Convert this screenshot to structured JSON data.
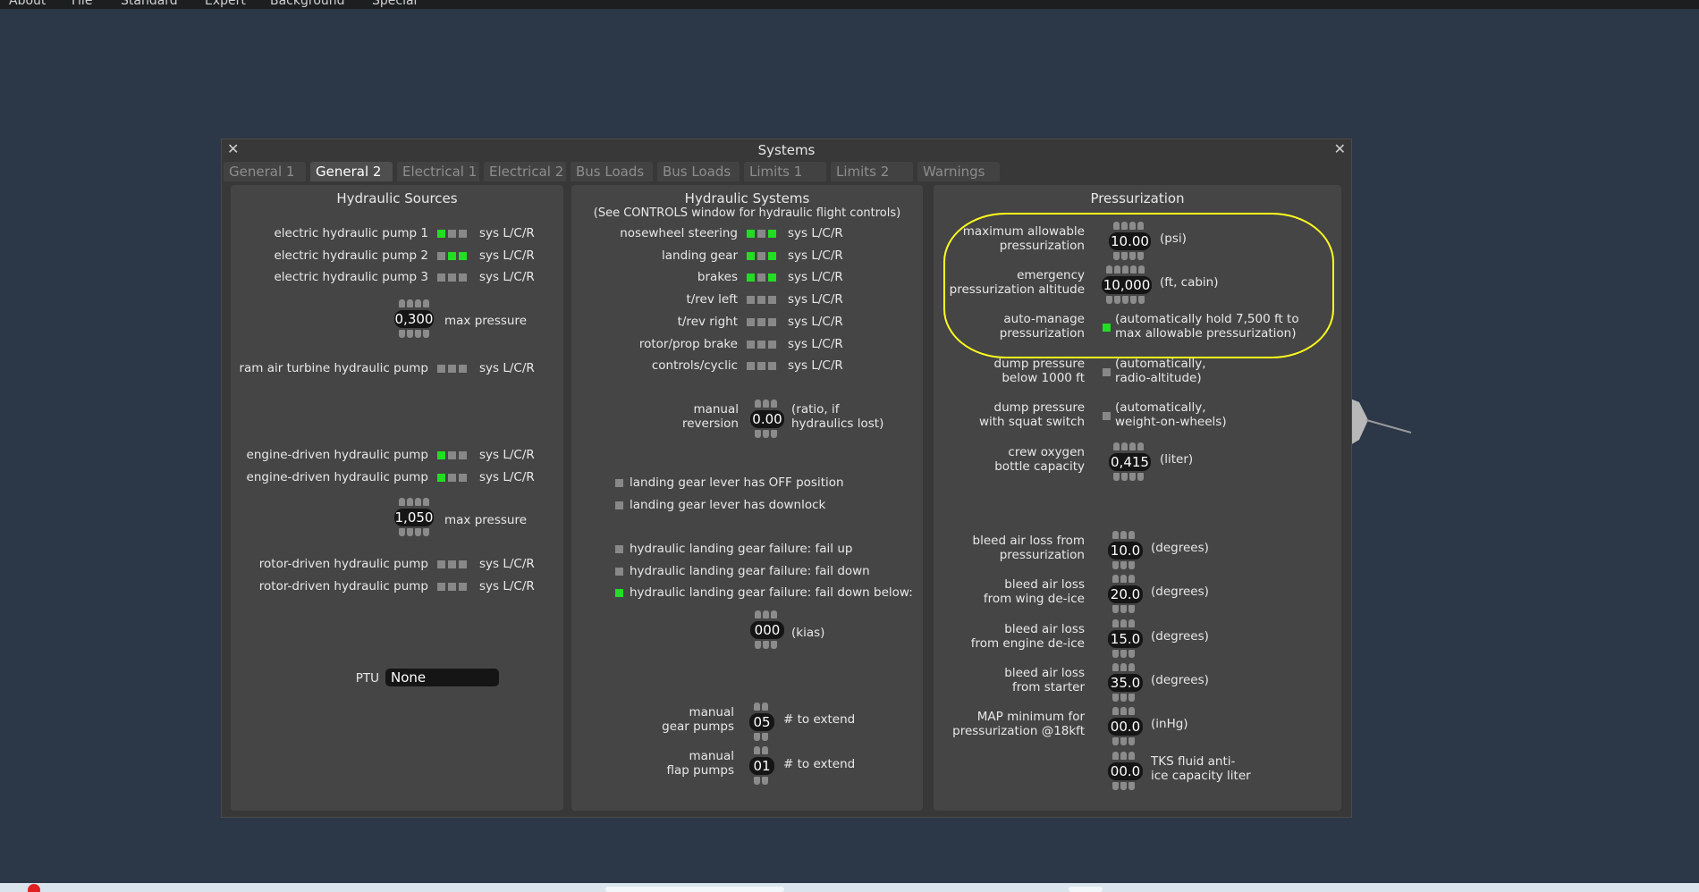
{
  "menu": [
    "About",
    "File",
    "Standard",
    "Expert",
    "Background",
    "Special"
  ],
  "window": {
    "title": "Systems",
    "tabs": [
      "General 1",
      "General 2",
      "Electrical 1",
      "Electrical 2",
      "Bus Loads",
      "Bus Loads",
      "Limits 1",
      "Limits 2",
      "Warnings"
    ],
    "active_tab": "General 2"
  },
  "hydraulic_sources": {
    "title": "Hydraulic Sources",
    "sys_label": "sys L/C/R",
    "rows": [
      {
        "label": "electric hydraulic pump 1",
        "states": [
          true,
          false,
          false
        ]
      },
      {
        "label": "electric hydraulic pump 2",
        "states": [
          false,
          true,
          true
        ]
      },
      {
        "label": "electric hydraulic pump 3",
        "states": [
          false,
          false,
          false
        ]
      },
      {
        "label": "ram air turbine hydraulic pump",
        "states": [
          false,
          false,
          false
        ]
      },
      {
        "label": "engine-driven hydraulic pump",
        "states": [
          true,
          false,
          false
        ]
      },
      {
        "label": "engine-driven hydraulic pump",
        "states": [
          true,
          false,
          false
        ]
      },
      {
        "label": "rotor-driven hydraulic pump",
        "states": [
          false,
          false,
          false
        ]
      },
      {
        "label": "rotor-driven hydraulic pump",
        "states": [
          false,
          false,
          false
        ]
      }
    ],
    "max_pressure_1": {
      "value": "0,300",
      "label": "max pressure"
    },
    "max_pressure_2": {
      "value": "1,050",
      "label": "max pressure"
    },
    "ptu_label": "PTU",
    "ptu_value": "None"
  },
  "hydraulic_systems": {
    "title": "Hydraulic Systems",
    "subtitle": "(See CONTROLS window for hydraulic flight controls)",
    "sys_label": "sys L/C/R",
    "rows": [
      {
        "label": "nosewheel steering",
        "states": [
          true,
          false,
          true
        ]
      },
      {
        "label": "landing gear",
        "states": [
          true,
          false,
          true
        ]
      },
      {
        "label": "brakes",
        "states": [
          true,
          false,
          true
        ]
      },
      {
        "label": "t/rev left",
        "states": [
          false,
          false,
          false
        ]
      },
      {
        "label": "t/rev right",
        "states": [
          false,
          false,
          false
        ]
      },
      {
        "label": "rotor/prop brake",
        "states": [
          false,
          false,
          false
        ]
      },
      {
        "label": "controls/cyclic",
        "states": [
          false,
          false,
          false
        ]
      }
    ],
    "manual_reversion": {
      "label1": "manual",
      "label2": "reversion",
      "value": "0.00",
      "unit1": "(ratio, if",
      "unit2": "hydraulics lost)"
    },
    "checks": [
      {
        "label": "landing gear lever has OFF position",
        "on": false
      },
      {
        "label": "landing gear lever has downlock",
        "on": false
      },
      {
        "label": "hydraulic landing gear failure: fail up",
        "on": false
      },
      {
        "label": "hydraulic landing gear failure: fail down",
        "on": false
      },
      {
        "label": "hydraulic landing gear failure: fail down below:",
        "on": true
      }
    ],
    "kias": {
      "value": "000",
      "unit": "(kias)"
    },
    "gear_pumps": {
      "label1": "manual",
      "label2": "gear pumps",
      "value": "05",
      "unit": "# to extend"
    },
    "flap_pumps": {
      "label1": "manual",
      "label2": "flap pumps",
      "value": "01",
      "unit": "# to extend"
    }
  },
  "pressurization": {
    "title": "Pressurization",
    "max_allowable": {
      "label1": "maximum allowable",
      "label2": "pressurization",
      "value": "10.00",
      "unit": "(psi)"
    },
    "emergency_alt": {
      "label1": "emergency",
      "label2": "pressurization altitude",
      "value": "10,000",
      "unit": "(ft, cabin)"
    },
    "auto_manage": {
      "label1": "auto-manage",
      "label2": "pressurization",
      "on": true,
      "note1": "(automatically hold 7,500 ft to",
      "note2": "max allowable pressurization)"
    },
    "dump_1000": {
      "label1": "dump pressure",
      "label2": "below 1000 ft",
      "on": false,
      "note1": "(automatically,",
      "note2": "radio-altitude)"
    },
    "dump_squat": {
      "label1": "dump pressure",
      "label2": "with squat switch",
      "on": false,
      "note1": "(automatically,",
      "note2": "weight-on-wheels)"
    },
    "crew_oxygen": {
      "label1": "crew oxygen",
      "label2": "bottle capacity",
      "value": "0,415",
      "unit": "(liter)"
    },
    "bleed_press": {
      "label1": "bleed air loss from",
      "label2": "pressurization",
      "value": "10.0",
      "unit": "(degrees)"
    },
    "bleed_wing": {
      "label1": "bleed air loss",
      "label2": "from wing de-ice",
      "value": "20.0",
      "unit": "(degrees)"
    },
    "bleed_engine": {
      "label1": "bleed air loss",
      "label2": "from engine de-ice",
      "value": "15.0",
      "unit": "(degrees)"
    },
    "bleed_starter": {
      "label1": "bleed air loss",
      "label2": "from starter",
      "value": "35.0",
      "unit": "(degrees)"
    },
    "map_min": {
      "label1": "MAP minimum for",
      "label2": "pressurization @18kft",
      "value": "00.0",
      "unit": "(inHg)"
    },
    "tks": {
      "value": "00.0",
      "unit1": "TKS fluid anti-",
      "unit2": "ice capacity liter"
    }
  },
  "colors": {
    "indicator_on": "#22dd22",
    "indicator_off": "#888888",
    "highlight": "#ffff1e",
    "background": "#2c3747"
  }
}
